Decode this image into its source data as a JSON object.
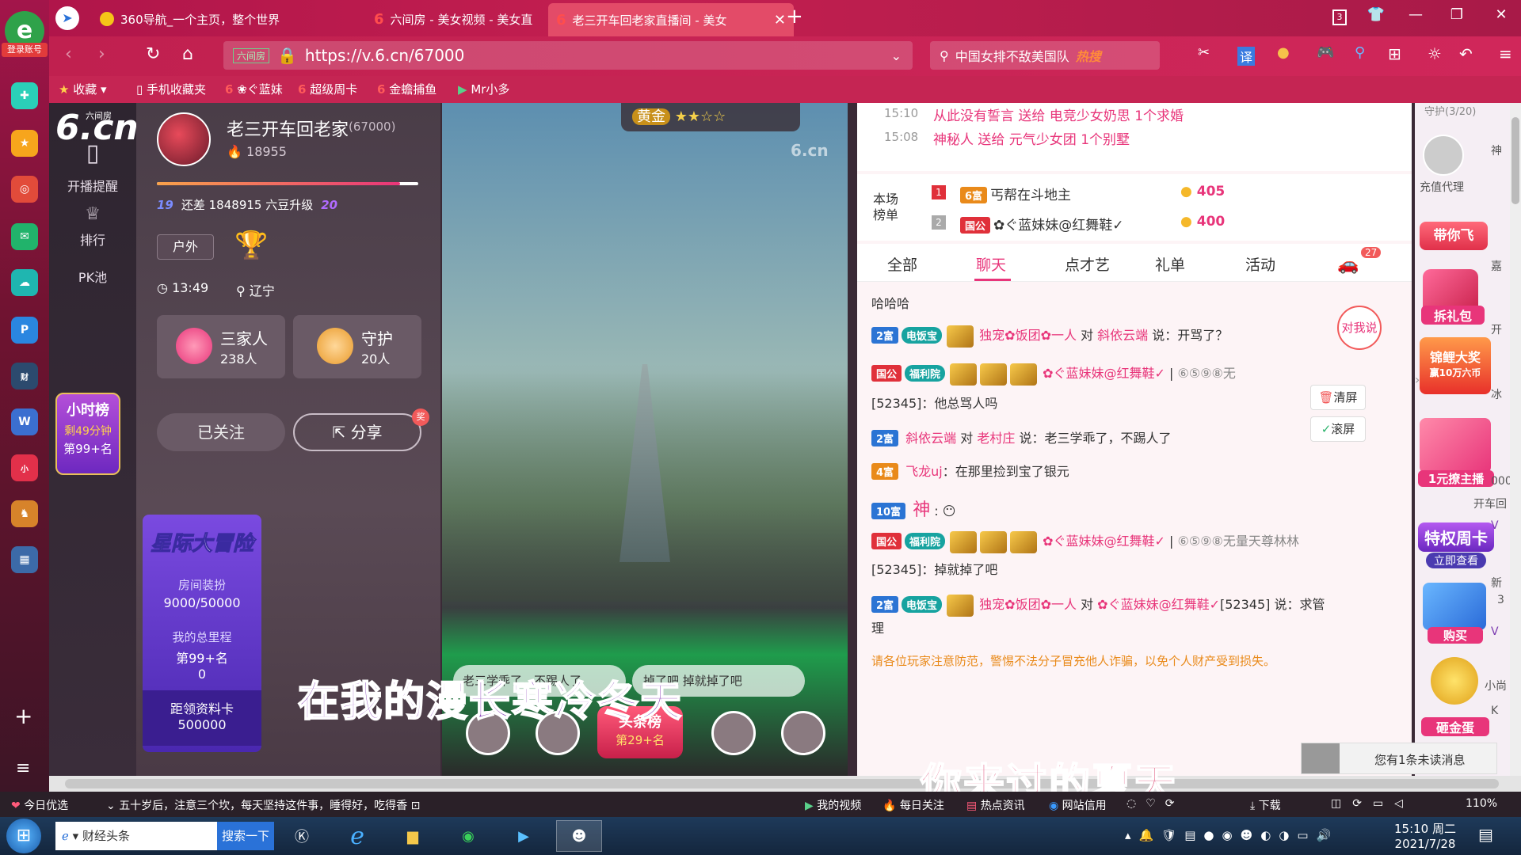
{
  "tabs": [
    {
      "label": "360导航_一个主页，整个世界"
    },
    {
      "label": "六间房 - 美女视频 - 美女直"
    },
    {
      "label": "老三开车回老家直播间 - 美女"
    }
  ],
  "window": {
    "tab_count": "3"
  },
  "leftbar": {
    "login": "登录账号",
    "items": [
      "小时榜",
      "剩49分钟",
      "第99+名"
    ]
  },
  "address": {
    "url": "https://v.6.cn/67000",
    "site_badge": "六间房"
  },
  "search": {
    "text": "中国女排不敌美国队",
    "hot": "热搜"
  },
  "bookmarks": [
    "收藏",
    "手机收藏夹",
    "❀ぐ蓝妹",
    "超级周卡",
    "金蟾捕鱼",
    "Mr小多"
  ],
  "site": {
    "logo_text": "六间房",
    "logo_cn": "6.cn",
    "nav": [
      "开播提醒",
      "排行",
      "PK池"
    ]
  },
  "profile": {
    "name": "老三开车回老家",
    "room_id": "(67000)",
    "fans": "18955",
    "level_text": "还差 1848915 六豆升级",
    "lv_from": "19",
    "lv_to": "20",
    "tag": "户外",
    "time": "13:49",
    "location": "辽宁",
    "family_label": "三家人",
    "family_count": "238人",
    "guard_label": "守护",
    "guard_count": "20人",
    "followed": "已关注",
    "share": "分享"
  },
  "promo": {
    "title": "星际大冒险",
    "dress_label": "房间装扮",
    "dress_value": "9000/50000",
    "mileage_label": "我的总里程",
    "mileage_rank": "第99+名",
    "mileage_value": "0",
    "card_label": "距领资料卡",
    "card_value": "500000"
  },
  "video": {
    "watermark": "6.cn",
    "medal": "黄金",
    "headline": "头条榜",
    "headline_rank": "第29+名",
    "bubble1": "老三学乖了，不踢人了",
    "bubble2": "掉了吧  掉就掉了吧"
  },
  "top_msgs": [
    {
      "time": "15:10",
      "text": "从此没有誓言 送给 电竞少女奶思 1个求婚"
    },
    {
      "time": "15:08",
      "text": "神秘人 送给 元气少女团 1个别墅"
    }
  ],
  "ranking": {
    "label": "本场榜单",
    "rows": [
      {
        "rank": "1",
        "badge": "6富",
        "name": "丐帮在斗地主",
        "score": "405"
      },
      {
        "rank": "2",
        "badge": "国公",
        "name": "✿ぐ蓝妹妹@红舞鞋✓",
        "score": "400"
      }
    ]
  },
  "chat_tabs": [
    "全部",
    "聊天",
    "点才艺",
    "礼单",
    "活动"
  ],
  "chat_car_badge": "27",
  "chat": {
    "l0": "哈哈哈",
    "l1_badge": "2富",
    "l1_fam": "电饭宝",
    "l1_user": "独宠✿饭团✿一人",
    "l1_to": "斜依云端",
    "l1_msg": "说：开骂了？",
    "l2_badge": "国公",
    "l2_fam": "福利院",
    "l2_user": "✿ぐ蓝妹妹@红舞鞋✓",
    "l2_id": "⑥⑤⑨⑧无",
    "l3": "[52345]：他总骂人吗",
    "l4_badge": "2富",
    "l4_user": "斜依云端",
    "l4_to": "老村庄",
    "l4_msg": "说：老三学乖了，不踢人了",
    "l5_badge": "4富",
    "l5_user": "飞龙uj",
    "l5_msg": "：在那里捡到宝了银元",
    "l6_badge": "10富",
    "l6_msg": "神",
    "l7_badge": "国公",
    "l7_fam": "福利院",
    "l7_user": "✿ぐ蓝妹妹@红舞鞋✓",
    "l7_id": "⑥⑤⑨⑧无量天尊林林",
    "l8": "[52345]：掉就掉了吧",
    "l9_badge": "2富",
    "l9_fam": "电饭宝",
    "l9_user": "独宠✿饭团✿一人",
    "l9_to": "✿ぐ蓝妹妹@红舞鞋✓",
    "l9_msg": "[52345] 说：求管",
    "l10": "理",
    "notice": "请各位玩家注意防范，警惕不法分子冒充他人诈骗，以免个人财产受到损失。",
    "clear": "清屏",
    "scroll": "滚屏",
    "talk": "对我说"
  },
  "right": {
    "guard": "守护(3/20)",
    "items": [
      "充值代理",
      "带你飞",
      "神秘...",
      "拆礼包",
      "锦鲤大奖",
      "赢10万六币",
      "1元撩主播",
      "特权周卡",
      "立即查看",
      "购买",
      "砸金蛋"
    ],
    "unread": "您有1条未读消息",
    "side": [
      "神",
      "嘉",
      "开",
      "冰",
      "000",
      "开车回",
      "V",
      "3",
      "新",
      "V",
      "小尚",
      "K"
    ]
  },
  "lyrics": {
    "l1": "在我的漫长寒冷冬天",
    "l2": "你来过的夏天"
  },
  "statusbar": {
    "left1": "今日优选",
    "left2": "五十岁后，注意三个坎，每天坚持这件事，睡得好，吃得香",
    "right": [
      "我的视频",
      "每日关注",
      "热点资讯",
      "网站信用",
      "下载"
    ],
    "zoom": "110%"
  },
  "taskbar": {
    "app": "财经头条",
    "search": "搜索一下",
    "time": "15:10 周二",
    "date": "2021/7/28"
  },
  "colors": {
    "accent": "#c31f50",
    "pink": "#e8357a",
    "blue": "#2b74d4"
  }
}
